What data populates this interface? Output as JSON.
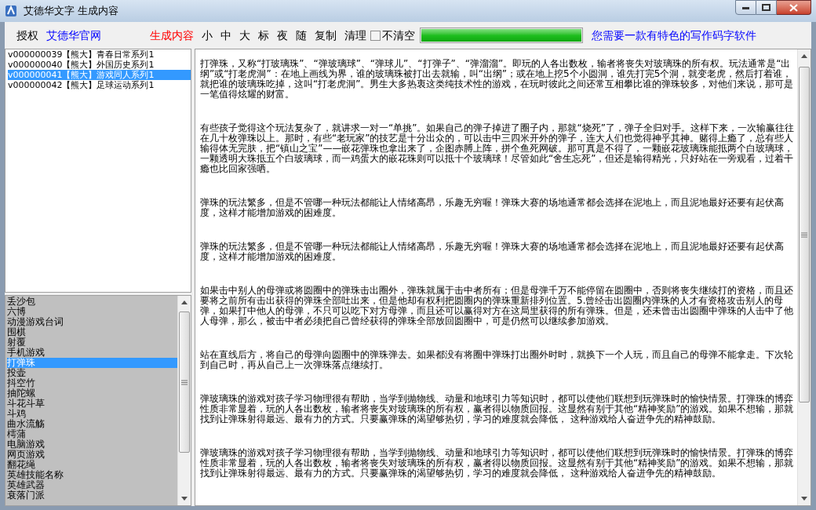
{
  "window": {
    "title": "艾德华文字 生成内容"
  },
  "toolbar": [
    {
      "kind": "plain",
      "label": "授权"
    },
    {
      "kind": "link",
      "label": "艾德华官网"
    },
    {
      "kind": "highlight",
      "label": "生成内容"
    },
    {
      "kind": "plain",
      "label": "小"
    },
    {
      "kind": "plain",
      "label": "中"
    },
    {
      "kind": "plain",
      "label": "大"
    },
    {
      "kind": "plain",
      "label": "标"
    },
    {
      "kind": "plain",
      "label": "夜"
    },
    {
      "kind": "plain",
      "label": "随"
    },
    {
      "kind": "plain",
      "label": "复制"
    },
    {
      "kind": "plain",
      "label": "清理"
    },
    {
      "kind": "checkbox",
      "label": "不清空",
      "checked": false
    },
    {
      "kind": "progress",
      "level": 1
    },
    {
      "kind": "link",
      "label": "您需要一款有特色的写作码字软件"
    }
  ],
  "series_list": [
    {
      "label": "v000000039【熊大】青春日常系列1",
      "selected": false
    },
    {
      "label": "v000000040【熊大】外国历史系列1",
      "selected": false
    },
    {
      "label": "v000000041【熊大】游戏同人系列1",
      "selected": true
    },
    {
      "label": "v000000042【熊大】足球运动系列1",
      "selected": false
    }
  ],
  "topic_list": [
    {
      "label": "丢沙包",
      "selected": false
    },
    {
      "label": "六博",
      "selected": false
    },
    {
      "label": "动漫游戏台词",
      "selected": false
    },
    {
      "label": "围棋",
      "selected": false
    },
    {
      "label": "射覆",
      "selected": false
    },
    {
      "label": "手机游戏",
      "selected": false
    },
    {
      "label": "打弹珠",
      "selected": true
    },
    {
      "label": "投壶",
      "selected": false
    },
    {
      "label": "抖空竹",
      "selected": false
    },
    {
      "label": "抽陀螺",
      "selected": false
    },
    {
      "label": "斗花斗草",
      "selected": false
    },
    {
      "label": "斗鸡",
      "selected": false
    },
    {
      "label": "曲水流觞",
      "selected": false
    },
    {
      "label": "樗蒲",
      "selected": false
    },
    {
      "label": "电脑游戏",
      "selected": false
    },
    {
      "label": "网页游戏",
      "selected": false
    },
    {
      "label": "翻花绳",
      "selected": false
    },
    {
      "label": "英雄技能名称",
      "selected": false
    },
    {
      "label": "英雄武器",
      "selected": false
    },
    {
      "label": "衰落门派",
      "selected": false
    }
  ],
  "content": [
    "打弹珠，又称“打玻璃珠”、“弹玻璃球”、“弹球儿”、“打弹子”、“弹溜溜”。即玩的人各出数枚，输者将丧失对玻璃珠的所有权。玩法通常是“出纲”或“打老虎洞”：在地上画线为界，谁的玻璃珠被打出去就输，叫“出纲”；或在地上挖5个小圆洞，谁先打完5个洞，就变老虎，然后打着谁，就把谁的玻璃珠吃掉，这叫“打老虎洞”。男生大多热衷这类纯技术性的游戏，在玩时彼此之间还常互相攀比谁的弹珠较多，对他们来说，那可是一笔值得炫耀的财富。",
    "有些孩子觉得这个玩法复杂了，就讲求一对一“单挑”。如果自己的弹子掉进了圈子内，那就“烧死”了，弹子全归对手。这样下来，一次输赢往往在几十枚弹珠以上。那时，有些“老玩家”的技艺是十分出众的，可以击中三四米开外的弹子，连大人们也觉得神乎其神。赌得上瘾了，总有些人输得体无完肤，把“镇山之宝”——嵌花弹珠也拿出来了，企图赤膊上阵，拼个鱼死网破。那可真是不得了，一颗嵌花玻璃珠能抵两个白玻璃球，一颗透明大珠抵五个白玻璃球，而一鸡蛋大的嵌花珠则可以抵十个玻璃球！尽管如此“舍生忘死”，但还是输得精光，只好站在一旁观看，过着干瘾也比回家强哂。",
    "弹珠的玩法繁多，但是不管哪一种玩法都能让人情绪高昂，乐趣无穷喔！弹珠大赛的场地通常都会选择在泥地上，而且泥地最好还要有起伏高度，这样才能增加游戏的困难度。",
    "弹珠的玩法繁多，但是不管哪一种玩法都能让人情绪高昂，乐趣无穷喔！弹珠大赛的场地通常都会选择在泥地上，而且泥地最好还要有起伏高度，这样才能增加游戏的困难度。",
    "如果击中别人的母弹或将圆圈中的弹珠击出圈外，弹珠就属于击中者所有；但是母弹千万不能停留在圆圈中，否则将丧失继续打的资格，而且还要将之前所有击出获得的弹珠全部吐出来，但是他却有权利把圆圈内的弹珠重新排列位置。5.曾经击出圆圈内弹珠的人才有资格攻击别人的母弹，如果打中他人的母弹，不只可以吃下对方母弹，而且还可以赢得对方在这局里获得的所有弹珠。但是，还未曾击出圆圈中弹珠的人击中了他人母弹，那么，被击中者必须把自己曾经获得的弹珠全部放回圆圈中，可是仍然可以继续参加游戏。",
    "站在直线后方，将自己的母弹向圆圈中的弹珠弹去。如果都没有将圈中弹珠打出圈外时时，就换下一个人玩，而且自己的母弹不能拿走。下次轮到自己时，再从自己上一次弹珠落点继续打。",
    "弹玻璃珠的游戏对孩子学习物理很有帮助，当学到抛物线、动量和地球引力等知识时，都可以使他们联想到玩弹珠时的愉快情景。打弹珠的博弈性质非常显着，玩的人各出数枚，输者将丧失对玻璃珠的所有权，赢者得以物质回报。这显然有别于其他“精神奖励”的游戏。如果不想输，那就找到让弹珠射得最远、最有力的方式。只要赢弹珠的渴望够热切，学习的难度就会降低， 这种游戏给人奋进争先的精神鼓励。",
    "弹玻璃珠的游戏对孩子学习物理很有帮助，当学到抛物线、动量和地球引力等知识时，都可以使他们联想到玩弹珠时的愉快情景。打弹珠的博弈性质非常显着，玩的人各出数枚，输者将丧失对玻璃珠的所有权，赢者得以物质回报。这显然有别于其他“精神奖励”的游戏。如果不想输，那就找到让弹珠射得最远、最有力的方式。只要赢弹珠的渴望够热切，学习的难度就会降低， 这种游戏给人奋进争先的精神鼓励。"
  ]
}
